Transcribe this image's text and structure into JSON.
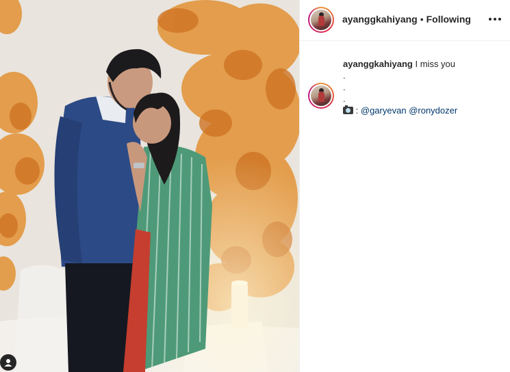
{
  "post": {
    "username": "ayanggkahiyang",
    "separator": "•",
    "follow_status": "Following",
    "caption_text": "I miss you",
    "caption_dots": [
      ".",
      ".",
      "."
    ],
    "credit_prefix": ":",
    "mentions": [
      "@garyevan",
      "@ronydozer"
    ]
  },
  "icons": {
    "more": "more-options-icon",
    "user_tag": "user-tag-icon",
    "camera": "camera-emoji-icon"
  },
  "colors": {
    "text": "#262626",
    "mention": "#00376b",
    "divider": "#efefef",
    "leaf": "#e08a32"
  }
}
